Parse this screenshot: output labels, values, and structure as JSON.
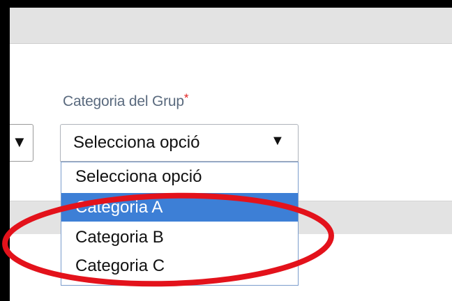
{
  "field": {
    "label": "Categoria del Grup",
    "required_mark": "*"
  },
  "left_select": {
    "arrow": "▼"
  },
  "select": {
    "value": "Selecciona opció",
    "arrow": "▼"
  },
  "dropdown": {
    "options": [
      {
        "label": "Selecciona opció",
        "selected": false
      },
      {
        "label": "Categoria A",
        "selected": true
      },
      {
        "label": "Categoria B",
        "selected": false
      },
      {
        "label": "Categoria C",
        "selected": false
      }
    ]
  },
  "colors": {
    "highlight": "#3d7fd6",
    "required": "#e32121",
    "annotation": "#e3121b",
    "label_text": "#5a6a7e"
  }
}
